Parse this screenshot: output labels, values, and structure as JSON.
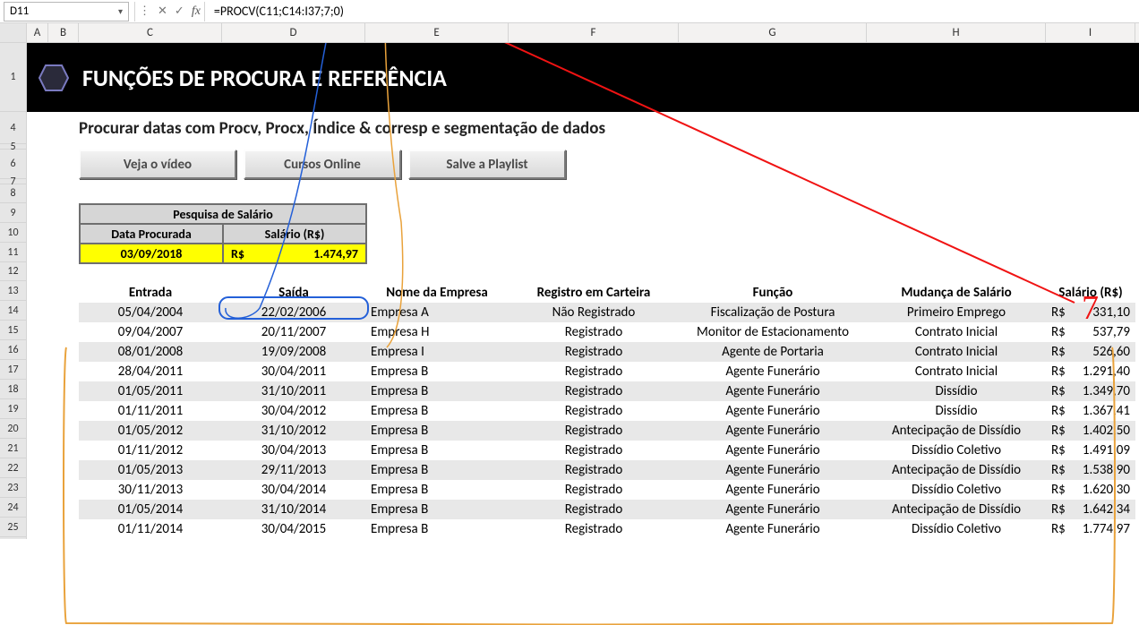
{
  "name_box": "D11",
  "formula": "=PROCV(C11;C14:I37;7;0)",
  "columns": [
    "A",
    "B",
    "C",
    "D",
    "E",
    "F",
    "G",
    "H",
    "I"
  ],
  "row_numbers_visible": [
    1,
    4,
    5,
    6,
    7,
    8,
    9,
    10,
    11,
    12,
    13,
    14,
    15,
    16,
    17,
    18,
    19,
    20,
    21,
    22,
    23,
    24,
    25
  ],
  "title": "FUNÇÕES DE PROCURA E REFERÊNCIA",
  "subtitle": "Procurar datas com Procv, Procx, Índice & corresp e segmentação de dados",
  "buttons": {
    "video": "Veja o vídeo",
    "cursos": "Cursos Online",
    "playlist": "Salve a Playlist"
  },
  "search_box": {
    "title": "Pesquisa de Salário",
    "h_data": "Data Procurada",
    "h_sal": "Salário (R$)",
    "data_val": "03/09/2018",
    "sal_cur": "R$",
    "sal_val": "1.474,97"
  },
  "table": {
    "headers": {
      "entrada": "Entrada",
      "saida": "Saída",
      "empresa": "Nome da Empresa",
      "registro": "Registro em Carteira",
      "funcao": "Função",
      "mudanca": "Mudança de Salário",
      "salario": "Salário (R$)"
    },
    "rows": [
      {
        "entrada": "05/04/2004",
        "saida": "22/02/2006",
        "empresa": "Empresa A",
        "registro": "Não Registrado",
        "funcao": "Fiscalização de Postura",
        "mudanca": "Primeiro Emprego",
        "cur": "R$",
        "val": "331,10"
      },
      {
        "entrada": "09/04/2007",
        "saida": "20/11/2007",
        "empresa": "Empresa H",
        "registro": "Registrado",
        "funcao": "Monitor de Estacionamento",
        "mudanca": "Contrato Inicial",
        "cur": "R$",
        "val": "537,79"
      },
      {
        "entrada": "08/01/2008",
        "saida": "19/09/2008",
        "empresa": "Empresa I",
        "registro": "Registrado",
        "funcao": "Agente de Portaria",
        "mudanca": "Contrato Inicial",
        "cur": "R$",
        "val": "526,60"
      },
      {
        "entrada": "28/04/2011",
        "saida": "30/04/2011",
        "empresa": "Empresa B",
        "registro": "Registrado",
        "funcao": "Agente Funerário",
        "mudanca": "Contrato Inicial",
        "cur": "R$",
        "val": "1.291,40"
      },
      {
        "entrada": "01/05/2011",
        "saida": "31/10/2011",
        "empresa": "Empresa B",
        "registro": "Registrado",
        "funcao": "Agente Funerário",
        "mudanca": "Dissídio",
        "cur": "R$",
        "val": "1.349,70"
      },
      {
        "entrada": "01/11/2011",
        "saida": "30/04/2012",
        "empresa": "Empresa B",
        "registro": "Registrado",
        "funcao": "Agente Funerário",
        "mudanca": "Dissídio",
        "cur": "R$",
        "val": "1.367,41"
      },
      {
        "entrada": "01/05/2012",
        "saida": "31/10/2012",
        "empresa": "Empresa B",
        "registro": "Registrado",
        "funcao": "Agente Funerário",
        "mudanca": "Antecipação de Dissídio",
        "cur": "R$",
        "val": "1.402,50"
      },
      {
        "entrada": "01/11/2012",
        "saida": "30/04/2013",
        "empresa": "Empresa B",
        "registro": "Registrado",
        "funcao": "Agente Funerário",
        "mudanca": "Dissídio Coletivo",
        "cur": "R$",
        "val": "1.491,09"
      },
      {
        "entrada": "01/05/2013",
        "saida": "29/11/2013",
        "empresa": "Empresa B",
        "registro": "Registrado",
        "funcao": "Agente Funerário",
        "mudanca": "Antecipação de Dissídio",
        "cur": "R$",
        "val": "1.538,90"
      },
      {
        "entrada": "30/11/2013",
        "saida": "30/04/2014",
        "empresa": "Empresa B",
        "registro": "Registrado",
        "funcao": "Agente Funerário",
        "mudanca": "Dissídio Coletivo",
        "cur": "R$",
        "val": "1.620,30"
      },
      {
        "entrada": "01/05/2014",
        "saida": "31/10/2014",
        "empresa": "Empresa B",
        "registro": "Registrado",
        "funcao": "Agente Funerário",
        "mudanca": "Antecipação de Dissídio",
        "cur": "R$",
        "val": "1.642,34"
      },
      {
        "entrada": "01/11/2014",
        "saida": "30/04/2015",
        "empresa": "Empresa B",
        "registro": "Registrado",
        "funcao": "Agente Funerário",
        "mudanca": "Dissídio Coletivo",
        "cur": "R$",
        "val": "1.774,97"
      }
    ]
  },
  "annotation_seven": "7"
}
